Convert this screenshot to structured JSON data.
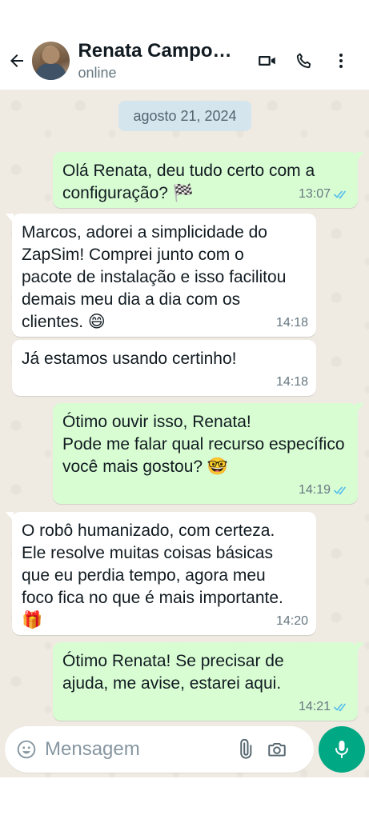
{
  "header": {
    "contact_name": "Renata Campo…",
    "status": "online",
    "icons": {
      "back": "arrow-back-icon",
      "video": "video-call-icon",
      "call": "phone-icon",
      "menu": "more-vertical-icon"
    }
  },
  "chat": {
    "date_chip": "agosto 21, 2024",
    "messages": [
      {
        "direction": "out",
        "text": "Olá Renata, deu tudo certo com a configuração? 🏁",
        "time": "13:07",
        "status": "read"
      },
      {
        "direction": "in",
        "text": " Marcos, adorei a simplicidade do ZapSim! Comprei junto com o pacote de instalação e isso facilitou demais meu dia a dia com os clientes. 😄",
        "time": "14:18"
      },
      {
        "direction": "in",
        "text": "Já estamos usando certinho!",
        "time": "14:18"
      },
      {
        "direction": "out",
        "text": "Ótimo ouvir isso, Renata!\nPode me falar qual recurso específico você mais gostou? 🤓",
        "time": "14:19",
        "status": "read"
      },
      {
        "direction": "in",
        "text": "O robô humanizado, com certeza. Ele resolve muitas coisas básicas que eu perdia tempo, agora meu foco fica no que é mais importante. 🎁",
        "time": "14:20"
      },
      {
        "direction": "out",
        "text": "Ótimo Renata! Se precisar de ajuda, me avise, estarei aqui.",
        "time": "14:21",
        "status": "read"
      }
    ]
  },
  "composer": {
    "placeholder": "Mensagem",
    "icons": {
      "emoji": "emoji-icon",
      "attach": "paperclip-icon",
      "camera": "camera-icon",
      "mic": "microphone-icon"
    }
  },
  "colors": {
    "outgoing_bubble": "#d9fdd3",
    "incoming_bubble": "#ffffff",
    "chat_background": "#efeae2",
    "read_tick": "#53bdeb",
    "accent": "#00a884"
  }
}
